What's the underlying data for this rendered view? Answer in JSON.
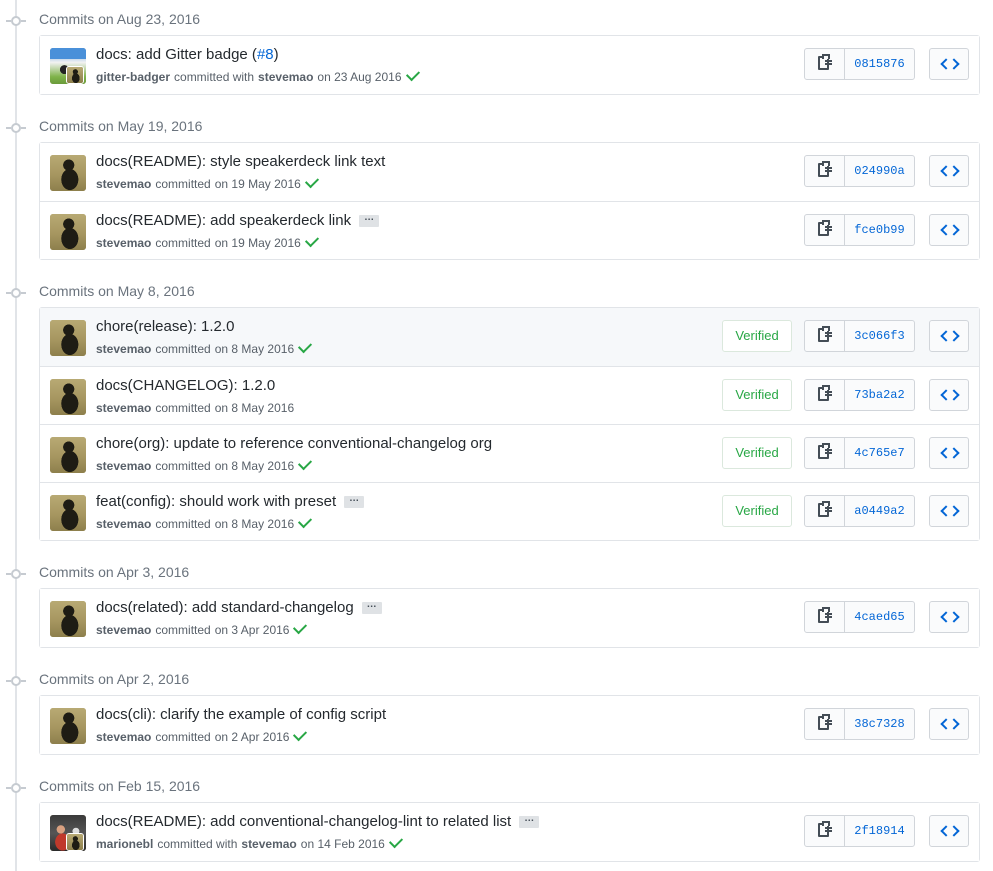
{
  "colors": {
    "verified_green": "#28a745",
    "sha_blue": "#0366d6",
    "muted_text": "#586069",
    "border": "#e1e4e8"
  },
  "groups": [
    {
      "header": "Commits on Aug 23, 2016",
      "commits": [
        {
          "title_prefix": "docs: add Gitter badge (",
          "issue": "#8",
          "title_suffix": ")",
          "avatar": "gitter-badger-avatar",
          "author": "gitter-badger",
          "verb": "committed with",
          "coauthor": "stevemao",
          "date": "on 23 Aug 2016",
          "ci_passed": true,
          "sha": "0815876"
        }
      ]
    },
    {
      "header": "Commits on May 19, 2016",
      "commits": [
        {
          "title": "docs(README): style speakerdeck link text",
          "avatar": "stevemao-avatar",
          "author": "stevemao",
          "verb": "committed",
          "date": "on 19 May 2016",
          "ci_passed": true,
          "sha": "024990a"
        },
        {
          "title": "docs(README): add speakerdeck link",
          "has_more": true,
          "ellipsis": "…",
          "avatar": "stevemao-avatar",
          "author": "stevemao",
          "verb": "committed",
          "date": "on 19 May 2016",
          "ci_passed": true,
          "sha": "fce0b99"
        }
      ]
    },
    {
      "header": "Commits on May 8, 2016",
      "commits": [
        {
          "title": "chore(release): 1.2.0",
          "avatar": "stevemao-avatar",
          "author": "stevemao",
          "verb": "committed",
          "date": "on 8 May 2016",
          "ci_passed": true,
          "verified": "Verified",
          "sha": "3c066f3",
          "highlighted": true
        },
        {
          "title": "docs(CHANGELOG): 1.2.0",
          "avatar": "stevemao-avatar",
          "author": "stevemao",
          "verb": "committed",
          "date": "on 8 May 2016",
          "ci_passed": false,
          "verified": "Verified",
          "sha": "73ba2a2"
        },
        {
          "title": "chore(org): update to reference conventional-changelog org",
          "avatar": "stevemao-avatar",
          "author": "stevemao",
          "verb": "committed",
          "date": "on 8 May 2016",
          "ci_passed": true,
          "verified": "Verified",
          "sha": "4c765e7"
        },
        {
          "title": "feat(config): should work with preset",
          "has_more": true,
          "ellipsis": "…",
          "avatar": "stevemao-avatar",
          "author": "stevemao",
          "verb": "committed",
          "date": "on 8 May 2016",
          "ci_passed": true,
          "verified": "Verified",
          "sha": "a0449a2"
        }
      ]
    },
    {
      "header": "Commits on Apr 3, 2016",
      "commits": [
        {
          "title": "docs(related): add standard-changelog",
          "has_more": true,
          "ellipsis": "…",
          "avatar": "stevemao-avatar",
          "author": "stevemao",
          "verb": "committed",
          "date": "on 3 Apr 2016",
          "ci_passed": true,
          "sha": "4caed65"
        }
      ]
    },
    {
      "header": "Commits on Apr 2, 2016",
      "commits": [
        {
          "title": "docs(cli): clarify the example of config script",
          "avatar": "stevemao-avatar",
          "author": "stevemao",
          "verb": "committed",
          "date": "on 2 Apr 2016",
          "ci_passed": true,
          "sha": "38c7328"
        }
      ]
    },
    {
      "header": "Commits on Feb 15, 2016",
      "commits": [
        {
          "title": "docs(README): add conventional-changelog-lint to related list",
          "has_more": true,
          "ellipsis": "…",
          "avatar": "marionebl-avatar",
          "author": "marionebl",
          "verb": "committed with",
          "coauthor": "stevemao",
          "date": "on 14 Feb 2016",
          "ci_passed": true,
          "sha": "2f18914"
        }
      ]
    }
  ]
}
